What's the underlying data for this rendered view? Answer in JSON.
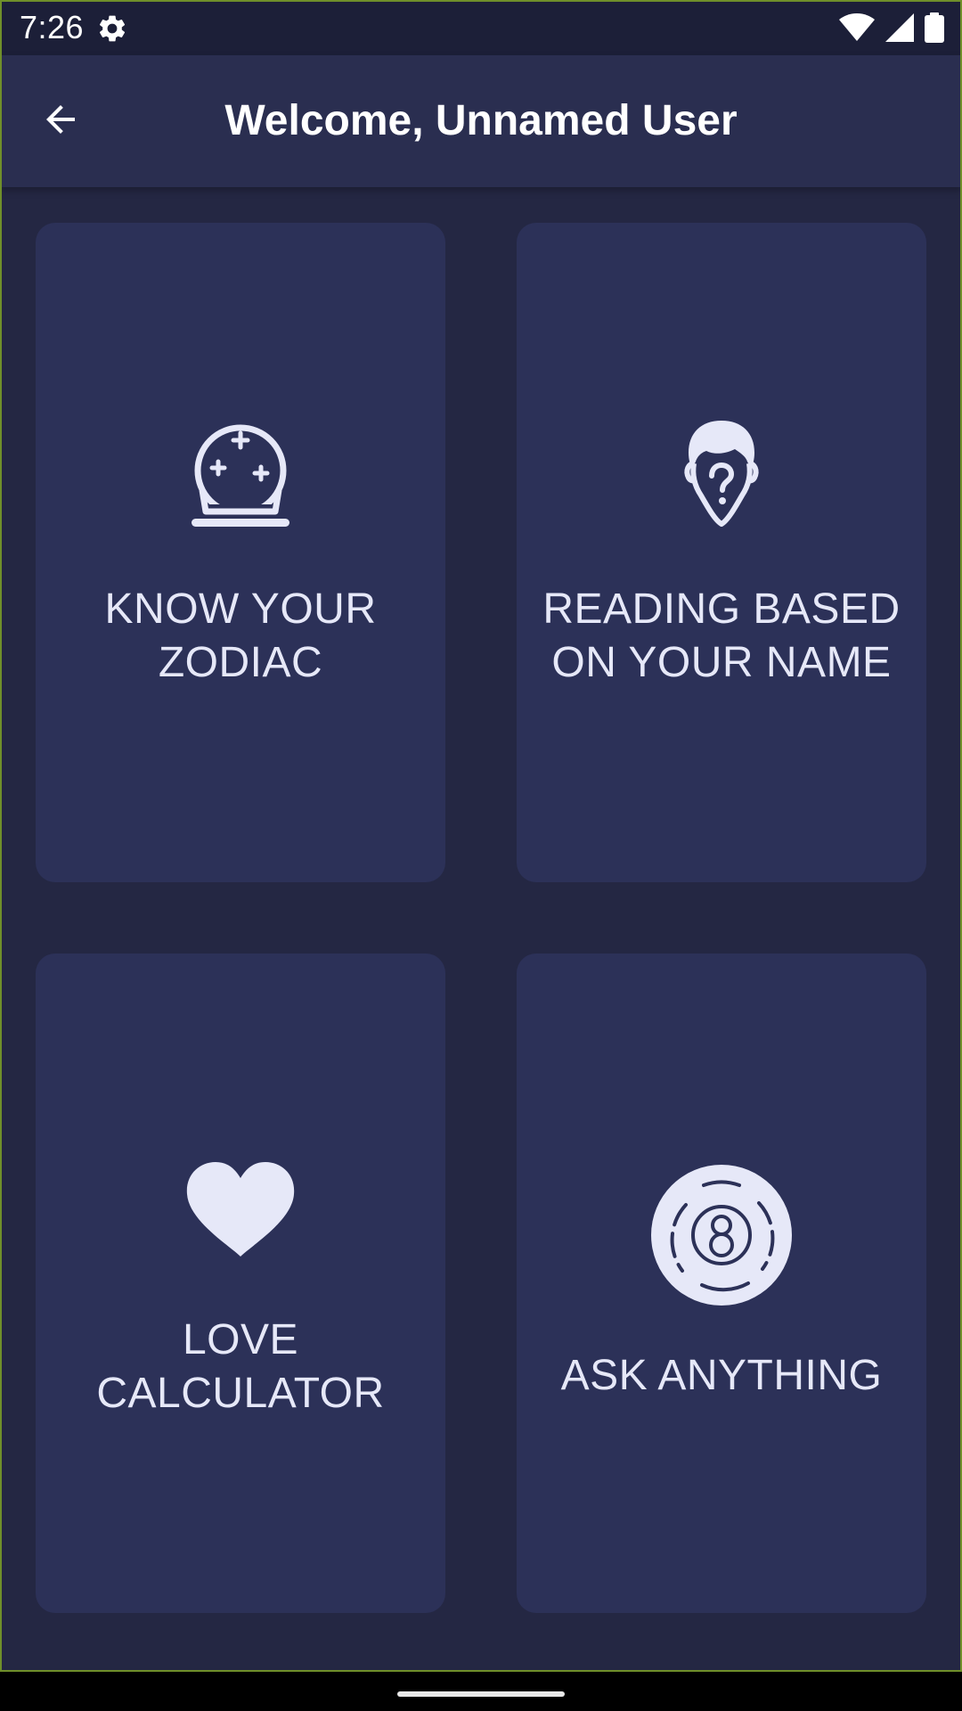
{
  "status_bar": {
    "time": "7:26",
    "icons": [
      "settings-gear-icon",
      "wifi-icon",
      "cell-signal-icon",
      "battery-icon"
    ]
  },
  "app_bar": {
    "back_icon": "arrow-left-icon",
    "title": "Welcome, Unnamed User"
  },
  "cards": [
    {
      "icon": "crystal-ball-icon",
      "label": "KNOW YOUR ZODIAC"
    },
    {
      "icon": "question-face-icon",
      "label": "READING BASED ON YOUR NAME"
    },
    {
      "icon": "heart-icon",
      "label": "LOVE CALCULATOR"
    },
    {
      "icon": "magic-8-ball-icon",
      "label": "ASK ANYTHING"
    }
  ],
  "colors": {
    "background": "#242743",
    "status_bar": "#1c1f38",
    "app_bar": "#2a2e50",
    "card": "#2c3158",
    "icon": "#e6e8f8",
    "text": "#e6e8f8"
  }
}
